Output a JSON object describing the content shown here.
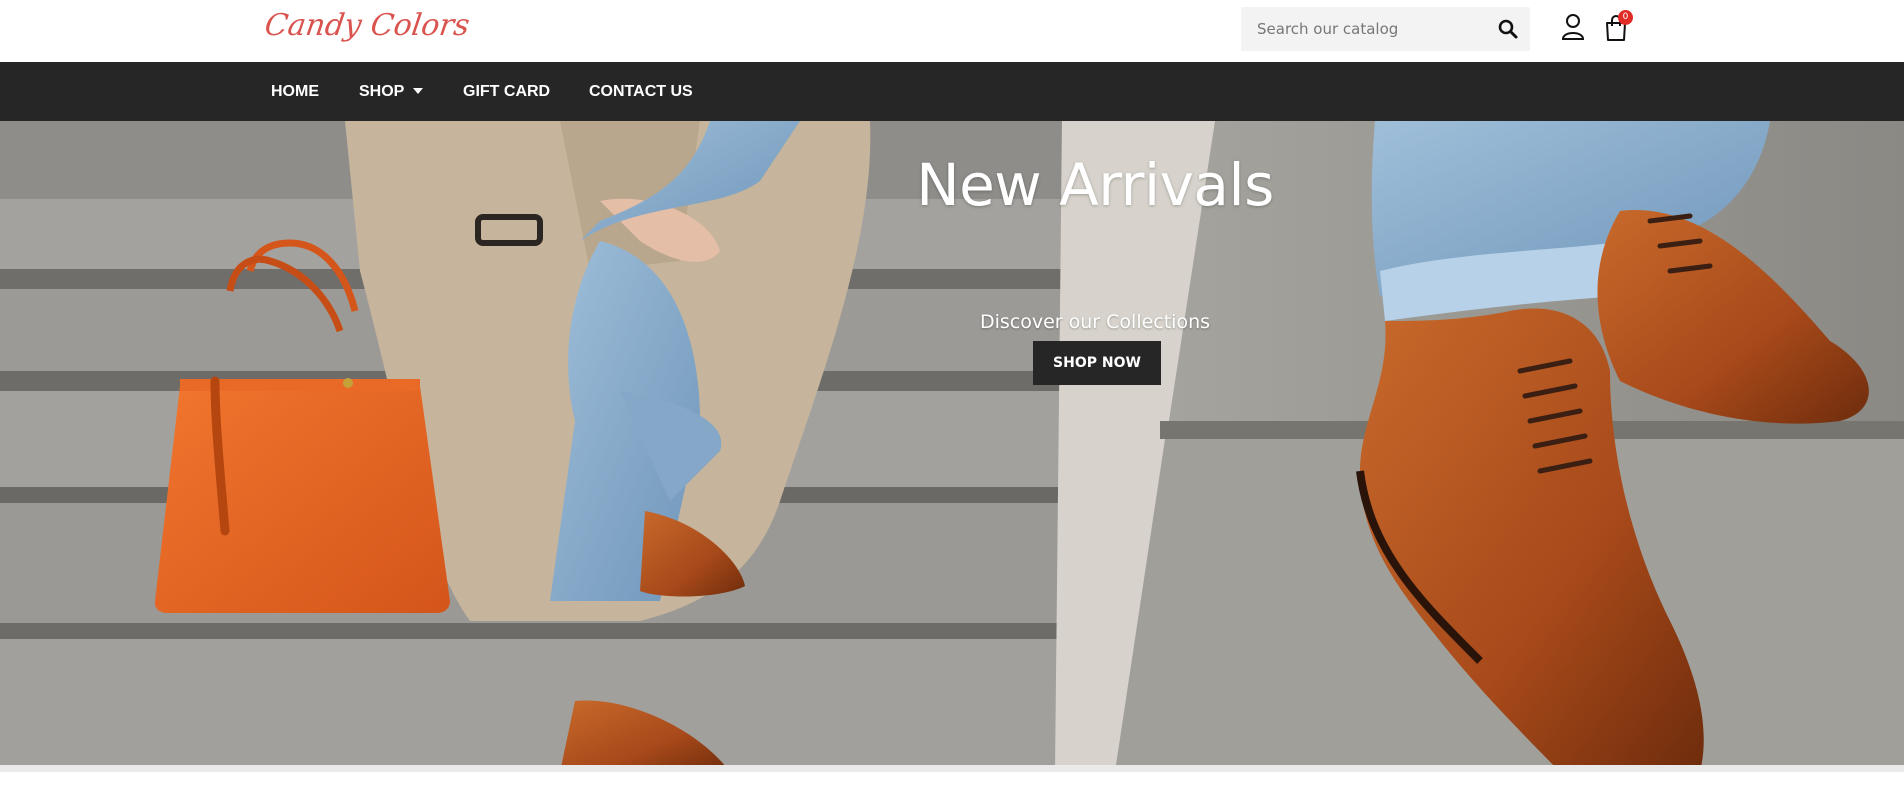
{
  "brand": {
    "logo_text": "Candy Colors",
    "logo_color": "#d9534f"
  },
  "search": {
    "placeholder": "Search our catalog",
    "value": "",
    "icon": "search-icon"
  },
  "header_icons": {
    "user": "user-icon",
    "cart": "shopping-bag-icon"
  },
  "cart": {
    "count": "0"
  },
  "nav": {
    "items": [
      {
        "label": "HOME"
      },
      {
        "label": "SHOP",
        "has_dropdown": true
      },
      {
        "label": "GIFT CARD"
      },
      {
        "label": "CONTACT US"
      }
    ]
  },
  "hero": {
    "title": "New Arrivals",
    "subtitle": "Discover our Collections",
    "button_label": "SHOP NOW"
  },
  "colors": {
    "nav_background": "#262626",
    "button_background": "#262626",
    "badge": "#e02b27"
  }
}
